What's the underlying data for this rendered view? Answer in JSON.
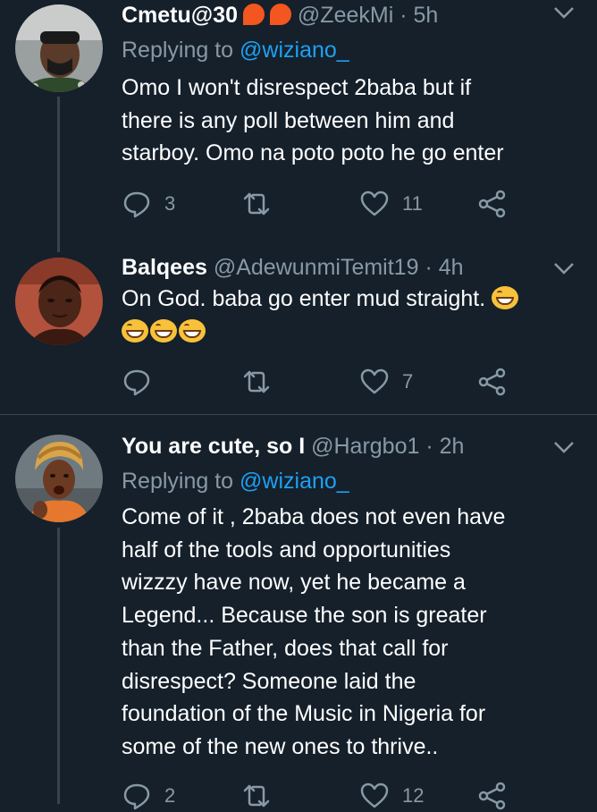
{
  "tweets": [
    {
      "name": "Cmetu@30",
      "handle": "@ZeekMi",
      "time": "· 5h",
      "replying_prefix": "Replying to",
      "replying_handle": "@wiziano_",
      "text_lines": [
        "Omo I won't disrespect 2baba but if",
        "there is any poll between him and",
        "starboy. Omo na poto poto he go enter"
      ],
      "replies": "3",
      "retweets": "",
      "likes": "11"
    },
    {
      "name": "Balqees",
      "handle": "@AdewunmiTemit19",
      "time": "· 4h",
      "text_lines": [
        "On God. baba go enter mud straight."
      ],
      "emoji_name": "grinning-squinting-face-emoji",
      "replies": "",
      "retweets": "",
      "likes": "7"
    },
    {
      "name": "You are cute, so I",
      "handle": "@Hargbo1",
      "time": "· 2h",
      "replying_prefix": "Replying to",
      "replying_handle": "@wiziano_",
      "text_lines": [
        "Come of it , 2baba does not even have",
        "half of the tools and opportunities",
        "wizzzy have now, yet he became a",
        "Legend... Because the son is greater",
        "than the Father, does that call for",
        "disrespect? Someone laid the",
        "foundation of the Music in Nigeria for",
        "some of the new ones to thrive.."
      ],
      "replies": "2",
      "retweets": "",
      "likes": "12"
    }
  ],
  "colors": {
    "background": "#15202b",
    "secondary_text": "#8899a6",
    "link": "#1da1f2",
    "divider": "#38444d"
  }
}
